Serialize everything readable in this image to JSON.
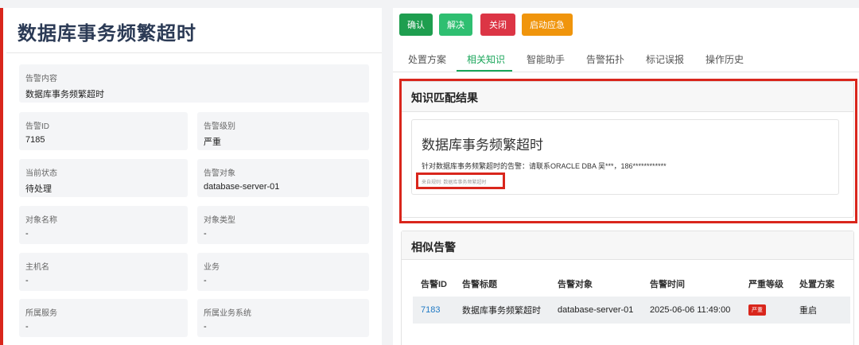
{
  "alert": {
    "title": "数据库事务频繁超时",
    "fields": [
      {
        "label": "告警内容",
        "value": "数据库事务频繁超时"
      },
      {
        "label": "告警ID",
        "value": "7185"
      },
      {
        "label": "告警级别",
        "value": "严重"
      },
      {
        "label": "当前状态",
        "value": "待处理"
      },
      {
        "label": "告警对象",
        "value": "database-server-01"
      },
      {
        "label": "对象名称",
        "value": "-"
      },
      {
        "label": "对象类型",
        "value": "-"
      },
      {
        "label": "主机名",
        "value": "-"
      },
      {
        "label": "业务",
        "value": "-"
      },
      {
        "label": "所属服务",
        "value": "-"
      },
      {
        "label": "所属业务系统",
        "value": "-"
      }
    ]
  },
  "actions": {
    "confirm": "确认",
    "resolve": "解决",
    "close": "关闭",
    "emergency": "启动应急",
    "colors": {
      "confirm": "#1e9e4f",
      "resolve": "#2fbf71",
      "close": "#dc3545",
      "emergency": "#f0950c"
    }
  },
  "tabs": [
    "处置方案",
    "相关知识",
    "智能助手",
    "告警拓扑",
    "标记误报",
    "操作历史"
  ],
  "active_tab": "相关知识",
  "knowledge": {
    "header": "知识匹配结果",
    "title": "数据库事务频繁超时",
    "description": "针对数据库事务频繁超时的告警：请联系ORACLE DBA 吴***，186************",
    "source": "来自规则: 数据库事务频繁超时"
  },
  "similar": {
    "header": "相似告警",
    "columns": [
      "告警ID",
      "告警标题",
      "告警对象",
      "告警时间",
      "严重等级",
      "处置方案"
    ],
    "rows": [
      {
        "id": "7183",
        "title": "数据库事务频繁超时",
        "object": "database-server-01",
        "time": "2025-06-06 11:49:00",
        "severity": "严重",
        "plan": "重启"
      }
    ]
  }
}
